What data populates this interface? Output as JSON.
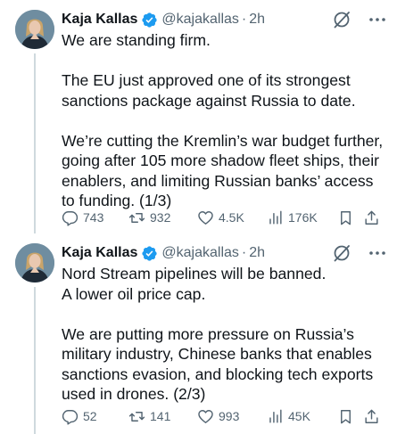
{
  "tweets": [
    {
      "author": {
        "name": "Kaja Kallas",
        "handle": "@kajakallas",
        "time": "2h"
      },
      "paragraphs": [
        "We are standing firm.",
        "The EU just approved one of its strongest sanctions package against Russia to date.",
        "We’re cutting the Kremlin’s war budget further, going after 105 more shadow fleet ships, their enablers, and limiting Russian banks’ access to funding. (1/3)"
      ],
      "stats": {
        "replies": "743",
        "reposts": "932",
        "likes": "4.5K",
        "views": "176K"
      }
    },
    {
      "author": {
        "name": "Kaja Kallas",
        "handle": "@kajakallas",
        "time": "2h"
      },
      "paragraphs": [
        "Nord Stream pipelines will be banned.\nA lower oil price cap.",
        "We are putting more pressure on Russia’s military industry, Chinese banks that enables sanctions evasion, and blocking tech exports used in drones. (2/3)"
      ],
      "stats": {
        "replies": "52",
        "reposts": "141",
        "likes": "993",
        "views": "45K"
      }
    }
  ],
  "colors": {
    "verified": "#1d9bf0",
    "secondary_text": "#536471",
    "thread_line": "#cfd9de"
  },
  "icons": [
    "verified-badge-icon",
    "grok-icon",
    "more-icon",
    "reply-icon",
    "repost-icon",
    "like-icon",
    "views-icon",
    "bookmark-icon",
    "share-icon"
  ]
}
